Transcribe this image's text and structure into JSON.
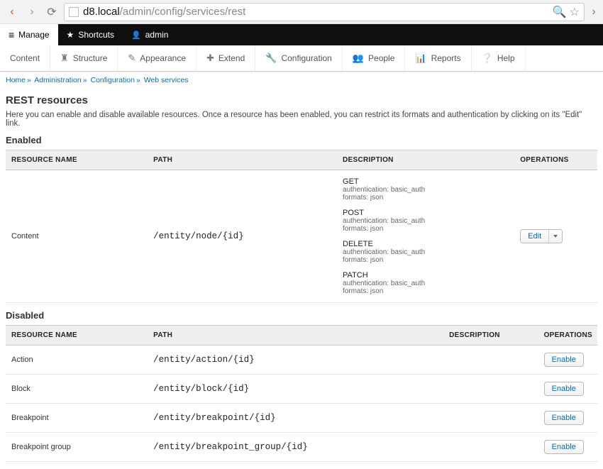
{
  "browser": {
    "url_host": "d8.local",
    "url_path": "/admin/config/services/rest"
  },
  "toolbar": {
    "manage": "Manage",
    "shortcuts": "Shortcuts",
    "user": "admin"
  },
  "admin_menu": {
    "content": "Content",
    "structure": "Structure",
    "appearance": "Appearance",
    "extend": "Extend",
    "configuration": "Configuration",
    "people": "People",
    "reports": "Reports",
    "help": "Help"
  },
  "breadcrumb": {
    "items": [
      "Home",
      "Administration",
      "Configuration",
      "Web services"
    ]
  },
  "page": {
    "title": "REST resources",
    "intro": "Here you can enable and disable available resources. Once a resource has been enabled, you can restrict its formats and authentication by clicking on its \"Edit\" link."
  },
  "headings": {
    "enabled": "Enabled",
    "disabled": "Disabled"
  },
  "columns": {
    "name": "RESOURCE NAME",
    "path": "PATH",
    "desc": "DESCRIPTION",
    "ops": "OPERATIONS"
  },
  "enabled_rows": [
    {
      "name": "Content",
      "path": "/entity/node/{id}",
      "methods": [
        {
          "verb": "GET",
          "auth": "authentication: basic_auth",
          "fmt": "formats: json"
        },
        {
          "verb": "POST",
          "auth": "authentication: basic_auth",
          "fmt": "formats: json"
        },
        {
          "verb": "DELETE",
          "auth": "authentication: basic_auth",
          "fmt": "formats: json"
        },
        {
          "verb": "PATCH",
          "auth": "authentication: basic_auth",
          "fmt": "formats: json"
        }
      ],
      "op": "Edit"
    }
  ],
  "disabled_rows": [
    {
      "name": "Action",
      "path": "/entity/action/{id}",
      "op": "Enable"
    },
    {
      "name": "Block",
      "path": "/entity/block/{id}",
      "op": "Enable"
    },
    {
      "name": "Breakpoint",
      "path": "/entity/breakpoint/{id}",
      "op": "Enable"
    },
    {
      "name": "Breakpoint group",
      "path": "/entity/breakpoint_group/{id}",
      "op": "Enable"
    }
  ]
}
